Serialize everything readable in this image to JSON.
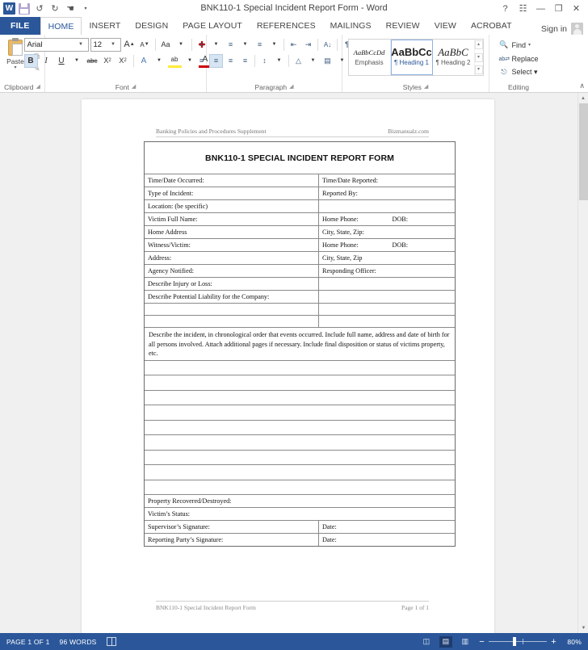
{
  "window": {
    "title": "BNK110-1 Special Incident Report Form - Word",
    "quick_access": [
      {
        "name": "word-logo",
        "label": "W"
      },
      {
        "name": "save-icon",
        "label": ""
      },
      {
        "name": "undo-icon",
        "label": "↺"
      },
      {
        "name": "redo-icon",
        "label": "↻"
      },
      {
        "name": "touch-mode-icon",
        "label": "☚"
      },
      {
        "name": "customize-qat-icon",
        "label": "▾"
      }
    ],
    "controls": [
      {
        "name": "help-button",
        "label": "?"
      },
      {
        "name": "ribbon-display-options-button",
        "label": "☷"
      },
      {
        "name": "minimize-button",
        "label": "—"
      },
      {
        "name": "maximize-button",
        "label": "❐"
      },
      {
        "name": "close-button",
        "label": "✕"
      }
    ],
    "sign_in": "Sign in"
  },
  "tabs": {
    "file": "FILE",
    "items": [
      "HOME",
      "INSERT",
      "DESIGN",
      "PAGE LAYOUT",
      "REFERENCES",
      "MAILINGS",
      "REVIEW",
      "VIEW",
      "ACROBAT"
    ],
    "active": "HOME"
  },
  "ribbon": {
    "clipboard": {
      "label": "Clipboard",
      "paste": "Paste",
      "paste_caret": "▾",
      "cut": "✂",
      "copy": "⧉",
      "format_painter": "✎"
    },
    "font": {
      "label": "Font",
      "font_name": "Arial",
      "font_size": "12",
      "grow_font": "A",
      "shrink_font": "A",
      "change_case": "Aa",
      "clear_formatting": "✐",
      "bold": "B",
      "italic": "I",
      "underline": "U",
      "strikethrough": "abc",
      "subscript": "X",
      "superscript": "X",
      "text_effects": "A",
      "highlight": "ab",
      "font_color": "A"
    },
    "paragraph": {
      "label": "Paragraph",
      "bullets": "≡",
      "numbering": "≡",
      "multilevel": "≡",
      "decrease_indent": "⇤",
      "increase_indent": "⇥",
      "sort": "A↓",
      "show_marks": "¶",
      "align_left": "≡",
      "align_center": "≡",
      "align_right": "≡",
      "justify": "≡",
      "line_spacing": "↕",
      "shading": "△",
      "borders": "▦"
    },
    "styles": {
      "label": "Styles",
      "items": [
        {
          "preview": "AaBbCcDd",
          "name": "Emphasis",
          "selected": false
        },
        {
          "preview": "AaBbCc",
          "name": "¶ Heading 1",
          "selected": true
        },
        {
          "preview": "AaBbC",
          "name": "¶ Heading 2",
          "selected": false
        }
      ],
      "scroll_up": "▴",
      "scroll_down": "▾",
      "more": "▾"
    },
    "editing": {
      "label": "Editing",
      "find": "Find",
      "find_caret": "▾",
      "replace": "Replace",
      "select": "Select ▾"
    },
    "collapse_ribbon": "∧"
  },
  "document": {
    "header_left": "Banking Policies and Procedures Supplement",
    "header_right": "Bizmanualz.com",
    "form_title": "BNK110-1 SPECIAL INCIDENT REPORT FORM",
    "rows": [
      {
        "left": "Time/Date Occurred:",
        "right": "Time/Date Reported:",
        "extra": ""
      },
      {
        "left": "Type of Incident:",
        "right": "Reported By:",
        "extra": ""
      },
      {
        "left": "Location:  (be specific)",
        "right": "",
        "extra": ""
      },
      {
        "left": "Victim Full Name:",
        "right": "Home Phone:",
        "extra": "DOB:"
      },
      {
        "left": "Home Address",
        "right": "City, State, Zip:",
        "extra": ""
      },
      {
        "left": "Witness/Victim:",
        "right": "Home Phone:",
        "extra": "DOB:"
      },
      {
        "left": "Address:",
        "right": "City, State, Zip",
        "extra": ""
      },
      {
        "left": "Agency Notified:",
        "right": "Responding Officer:",
        "extra": ""
      },
      {
        "left": "Describe Injury or Loss:",
        "right": "",
        "extra": ""
      },
      {
        "left": "Describe Potential Liability for the Company:",
        "right": "",
        "extra": ""
      }
    ],
    "empty_split_rows": 2,
    "narrative": "Describe the incident, in chronological order that events occurred.  Include full name, address and date of birth for all persons involved.  Attach additional pages if necessary.  Include final disposition or status of victims property, etc.",
    "blank_lines": 9,
    "bottom_rows": [
      {
        "left": "Property Recovered/Destroyed:",
        "right": null
      },
      {
        "left": "Victim’s Status:",
        "right": null
      },
      {
        "left": "Supervisor’s Signature:",
        "right": "Date:"
      },
      {
        "left": "Reporting Party’s Signature:",
        "right": "Date:"
      }
    ],
    "footer_left": "BNK110-1 Special Incident Report Form",
    "footer_right": "Page 1 of 1"
  },
  "statusbar": {
    "page": "PAGE 1 OF 1",
    "words": "96 WORDS",
    "proofing_icon": "spelling-check-icon",
    "views": [
      {
        "name": "read-mode-view-button",
        "glyph": "◫",
        "selected": false
      },
      {
        "name": "print-layout-view-button",
        "glyph": "▤",
        "selected": true
      },
      {
        "name": "web-layout-view-button",
        "glyph": "▥",
        "selected": false
      }
    ],
    "zoom_out": "−",
    "zoom_in": "+",
    "zoom_level": "80%"
  },
  "colors": {
    "accent": "#2b579a",
    "ribbon_bg": "#ffffff",
    "doc_bg": "#f0f0f0"
  }
}
